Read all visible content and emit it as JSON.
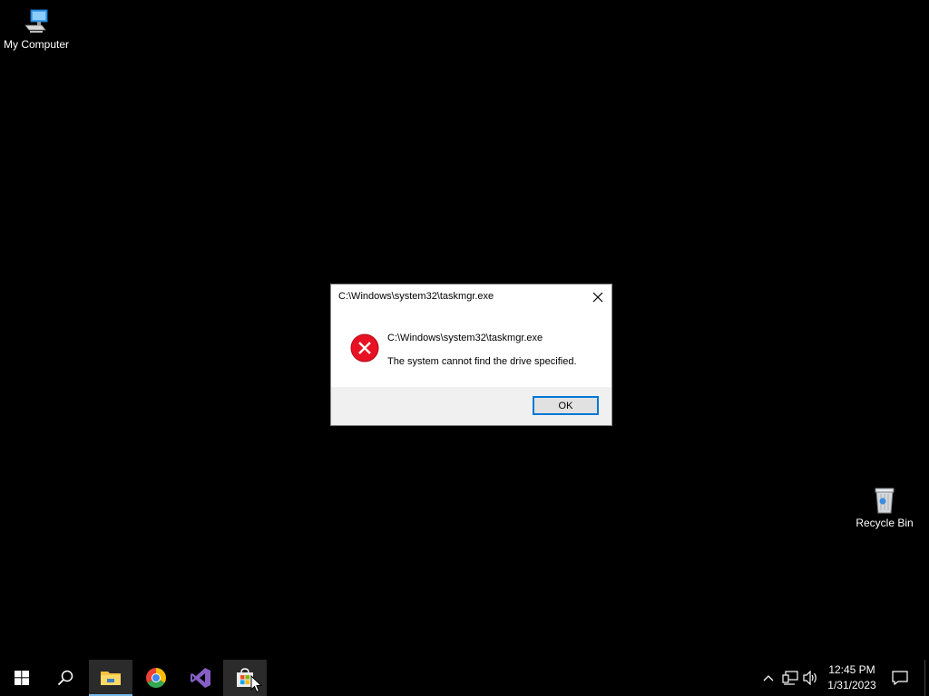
{
  "desktop": {
    "icons": [
      {
        "label": "My Computer",
        "icon": "computer-icon"
      },
      {
        "label": "Recycle Bin",
        "icon": "recycle-bin-icon"
      }
    ]
  },
  "dialog": {
    "title": "C:\\Windows\\system32\\taskmgr.exe",
    "message_path": "C:\\Windows\\system32\\taskmgr.exe",
    "message_text": "The system cannot find the drive specified.",
    "ok_label": "OK",
    "icon": "error-icon",
    "close_icon": "close-icon"
  },
  "taskbar": {
    "start_icon": "windows-start-icon",
    "search_icon": "search-icon",
    "apps": [
      {
        "name": "File Explorer",
        "icon": "folder-icon",
        "state": "open-active"
      },
      {
        "name": "Google Chrome",
        "icon": "chrome-icon"
      },
      {
        "name": "Visual Studio",
        "icon": "visual-studio-icon"
      },
      {
        "name": "Microsoft Store",
        "icon": "store-icon",
        "state": "hover"
      }
    ],
    "tray": {
      "icons": [
        "chevron-up-icon",
        "network-icon",
        "volume-icon"
      ],
      "time": "12:45 PM",
      "date": "1/31/2023",
      "notification_icon": "notification-icon"
    }
  },
  "colors": {
    "desktop_bg": "#000000",
    "accent": "#0078d7",
    "error_red": "#e81123",
    "taskbar_underline": "#76b9ed"
  }
}
